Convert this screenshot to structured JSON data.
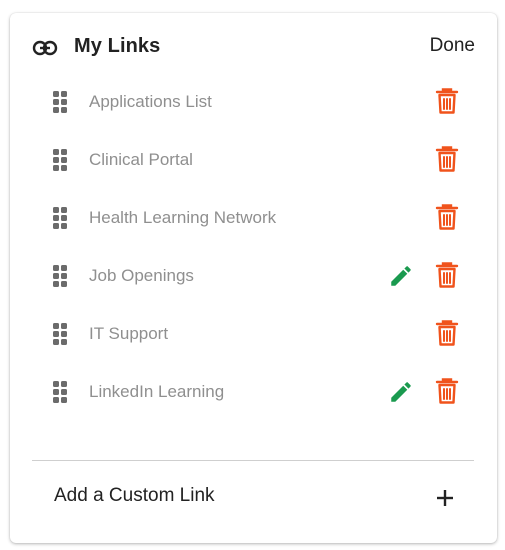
{
  "header": {
    "title": "My Links",
    "done_label": "Done",
    "icon": "link-icon"
  },
  "links": [
    {
      "label": "Applications List",
      "editable": false
    },
    {
      "label": "Clinical Portal",
      "editable": false
    },
    {
      "label": "Health Learning Network",
      "editable": false
    },
    {
      "label": "Job Openings",
      "editable": true
    },
    {
      "label": "IT Support",
      "editable": false
    },
    {
      "label": "LinkedIn Learning",
      "editable": true
    }
  ],
  "footer": {
    "add_label": "Add a Custom Link",
    "add_icon": "plus-icon"
  },
  "icons": {
    "drag": "drag-handle-icon",
    "edit": "pencil-icon",
    "delete": "trash-icon"
  },
  "colors": {
    "delete": "#f0531c",
    "edit": "#1a9a4f",
    "drag": "#6b6b6b",
    "label": "#8f8f8f",
    "text": "#222222"
  }
}
